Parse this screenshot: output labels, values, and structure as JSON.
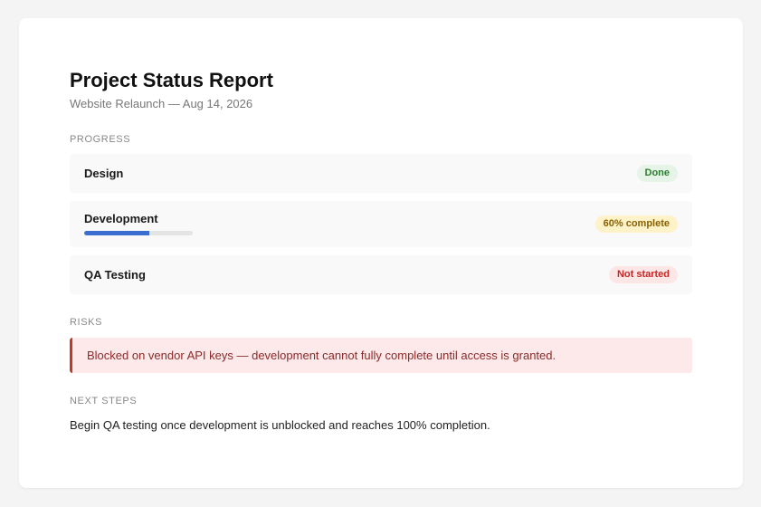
{
  "report": {
    "title": "Project Status Report",
    "subtitle": "Website Relaunch — Aug 14, 2026"
  },
  "progress": {
    "label": "PROGRESS",
    "items": [
      {
        "name": "Design",
        "status": "Done"
      },
      {
        "name": "Development",
        "status": "60% complete",
        "percent": 60
      },
      {
        "name": "QA Testing",
        "status": "Not started"
      }
    ]
  },
  "risks": {
    "label": "RISKS",
    "text": "Blocked on vendor API keys — development cannot fully complete until access is granted."
  },
  "next_steps": {
    "label": "NEXT STEPS",
    "text": "Begin QA testing once development is unblocked and reaches 100% completion."
  },
  "colors": {
    "progress_bar": "#3a6fcf",
    "done": "#2e7d32",
    "in_progress": "#8a6100",
    "not_started": "#c62828",
    "risk_border": "#c0392b"
  }
}
